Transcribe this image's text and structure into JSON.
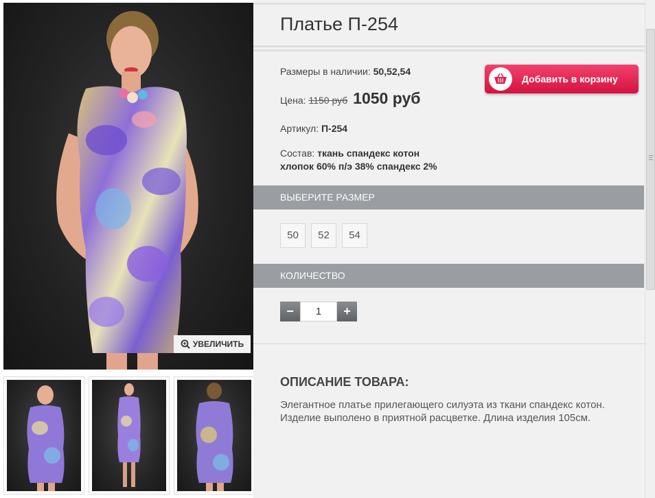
{
  "product": {
    "title": "Платье П-254",
    "sizes_available_label": "Размеры в наличии:",
    "sizes_available_value": "50,52,54",
    "price_label": "Цена:",
    "price_old": "1150 руб",
    "price_new": "1050 руб",
    "sku_label": "Артикул:",
    "sku_value": "П-254",
    "composition_label": "Состав:",
    "composition_value_line1": "ткань спандекс котон",
    "composition_value_line2": "хлопок 60% п/э 38% спандекс 2%",
    "add_to_cart_label": "Добавить в корзину"
  },
  "gallery": {
    "zoom_label": "УВЕЛИЧИТЬ",
    "thumbnails": [
      "front-view",
      "full-length-view",
      "back-view"
    ]
  },
  "size_section": {
    "title": "ВЫБЕРИТЕ РАЗМЕР",
    "options": [
      "50",
      "52",
      "54"
    ]
  },
  "quantity_section": {
    "title": "КОЛИЧЕСТВО",
    "minus_label": "−",
    "value": "1",
    "plus_label": "+"
  },
  "description": {
    "title": "ОПИСАНИЕ ТОВАРА:",
    "text": "Элегантное платье прилегающего силуэта из ткани  спандекс котон. Изделие выполено в приятной расцветке. Длина изделия 105см."
  },
  "colors": {
    "cart_button": "#e0204e",
    "section_bar": "#9a9da1",
    "panel_bg": "#f1f1f1",
    "photo_bg": "#232323"
  }
}
